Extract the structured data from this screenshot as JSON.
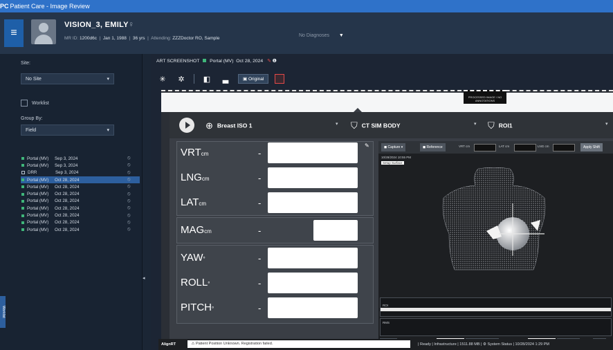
{
  "app": {
    "icon_text": "PC",
    "title": "Patient Care - Image Review"
  },
  "patient": {
    "name": "VISION_3, EMILY",
    "gender_symbol": "♀",
    "mrn_label": "MR ID:",
    "mrn": "1200d6c",
    "dob": "Jan 1, 1988",
    "age": "36 yrs",
    "attending_label": "Attending:",
    "attending": "ZZZDoctor RO, Sample",
    "diagnosis": "No Diagnoses"
  },
  "sidebar": {
    "site_label": "Site:",
    "site_value": "No Site",
    "worklist_label": "Worklist",
    "group_by_label": "Group By:",
    "group_by_value": "Field",
    "images": [
      {
        "type": "Portal (MV)",
        "date": "Sep 3, 2024",
        "kind": "portal",
        "selected": false
      },
      {
        "type": "Portal (MV)",
        "date": "Sep 3, 2024",
        "kind": "portal",
        "selected": false
      },
      {
        "type": "DRR",
        "date": "Sep 3, 2024",
        "kind": "drr",
        "selected": false
      },
      {
        "type": "Portal (MV)",
        "date": "Oct 28, 2024",
        "kind": "portal",
        "selected": true
      },
      {
        "type": "Portal (MV)",
        "date": "Oct 28, 2024",
        "kind": "portal",
        "selected": false
      },
      {
        "type": "Portal (MV)",
        "date": "Oct 28, 2024",
        "kind": "portal",
        "selected": false
      },
      {
        "type": "Portal (MV)",
        "date": "Oct 28, 2024",
        "kind": "portal",
        "selected": false
      },
      {
        "type": "Portal (MV)",
        "date": "Oct 28, 2024",
        "kind": "portal",
        "selected": false
      },
      {
        "type": "Portal (MV)",
        "date": "Oct 28, 2024",
        "kind": "portal",
        "selected": false
      },
      {
        "type": "Portal (MV)",
        "date": "Oct 28, 2024",
        "kind": "portal",
        "selected": false
      },
      {
        "type": "Portal (MV)",
        "date": "Oct 28, 2024",
        "kind": "portal",
        "selected": false
      }
    ],
    "side_tab": "Worklist"
  },
  "image_header": {
    "name": "ART SCREENSHOT",
    "type": "Portal (MV)",
    "date": "Oct 28, 2024"
  },
  "toolbar": {
    "original_label": "Original"
  },
  "stamp_text": "PROCESSED IMAGE / NO ANNOTATIONS",
  "setup": {
    "isocenter": "Breast ISO 1",
    "structure_set": "CT SIM BODY",
    "roi": "ROI1",
    "fields": [
      {
        "label": "VRT",
        "unit": "cm",
        "value": "-"
      },
      {
        "label": "LNG",
        "unit": "cm",
        "value": "-"
      },
      {
        "label": "LAT",
        "unit": "cm",
        "value": "-"
      },
      {
        "label": "MAG",
        "unit": "cm",
        "value": "-"
      },
      {
        "label": "YAW",
        "unit": "°",
        "value": "-"
      },
      {
        "label": "ROLL",
        "unit": "°",
        "value": "-"
      },
      {
        "label": "PITCH",
        "unit": "°",
        "value": "-"
      }
    ]
  },
  "surface_view": {
    "capture_label": "Capture",
    "reference_label": "Reference",
    "vrt_label": "VRT cm",
    "lat_label": "LAT cm",
    "lng_label": "LNG cm",
    "apply_label": "Apply Shift",
    "info_line": "10/28/2024 10:55 PM",
    "tag": "Setup Surface",
    "strip1_label": "ROI",
    "strip2_label": "RMS",
    "bottom_left": "Tracking",
    "bottom_mid": "Treatment",
    "bottom_right1": "Deformation",
    "bottom_right2": "Video"
  },
  "status": {
    "logo": "AlignRT",
    "message": "Patient Position Unknown. Registration failed.",
    "ready": "Ready | Infrastructure",
    "memory": "1511.88 MB",
    "system": "System Status",
    "datetime": "10/28/2024 1:29 PM"
  }
}
